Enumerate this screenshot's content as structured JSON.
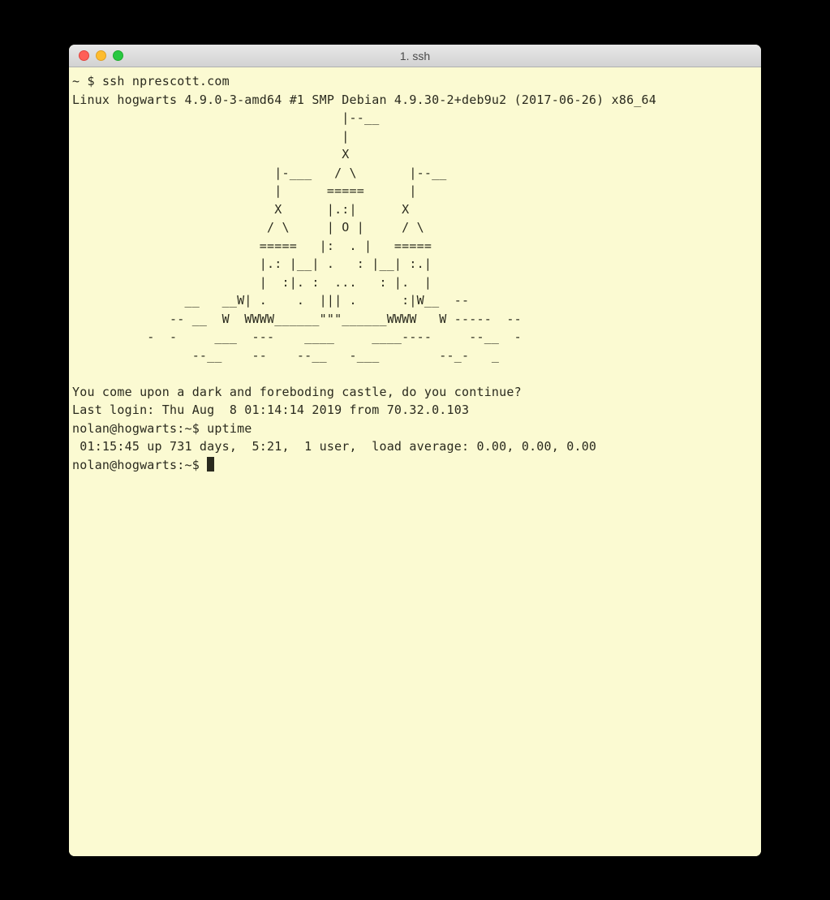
{
  "window": {
    "title": "1. ssh"
  },
  "terminal": {
    "local_prompt": "~ $ ",
    "ssh_command": "ssh nprescott.com",
    "banner_line": "Linux hogwarts 4.9.0-3-amd64 #1 SMP Debian 4.9.30-2+deb9u2 (2017-06-26) x86_64",
    "ascii_art": "                                    |--__\n                                    |\n                                    X\n                           |-___   / \\       |--__\n                           |      =====      |\n                           X      |.:|      X\n                          / \\     | O |     / \\\n                         =====   |:  . |   =====\n                         |.: |__| .   : |__| :.|\n                         |  :|. :  ...   : |.  |\n               __   __W| .    .  ||| .      :|W__  --\n             -- __  W  WWWW______\"\"\"______WWWW   W -----  --\n          -  -     ___  ---    ____     ____----     --__  -\n                --__    --    --__   -___        --_-   _",
    "motd_line": "You come upon a dark and foreboding castle, do you continue?",
    "last_login": "Last login: Thu Aug  8 01:14:14 2019 from 70.32.0.103",
    "remote_prompt": "nolan@hogwarts:~$ ",
    "uptime_command": "uptime",
    "uptime_output": " 01:15:45 up 731 days,  5:21,  1 user,  load average: 0.00, 0.00, 0.00"
  }
}
